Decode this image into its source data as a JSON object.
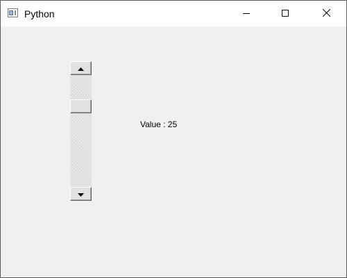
{
  "window": {
    "title": "Python",
    "icon": "python-app-icon",
    "controls": {
      "minimize_icon": "minimize-icon",
      "maximize_icon": "maximize-icon",
      "close_icon": "close-icon"
    }
  },
  "scrollbar": {
    "orientation": "vertical",
    "value": 25,
    "min": 0,
    "max": 100,
    "up_icon": "arrow-up-icon",
    "down_icon": "arrow-down-icon"
  },
  "label": {
    "text": "Value : 25"
  },
  "colors": {
    "window_bg": "#f0f0f0",
    "titlebar_bg": "#ffffff",
    "button_face": "#e1e1e1"
  }
}
